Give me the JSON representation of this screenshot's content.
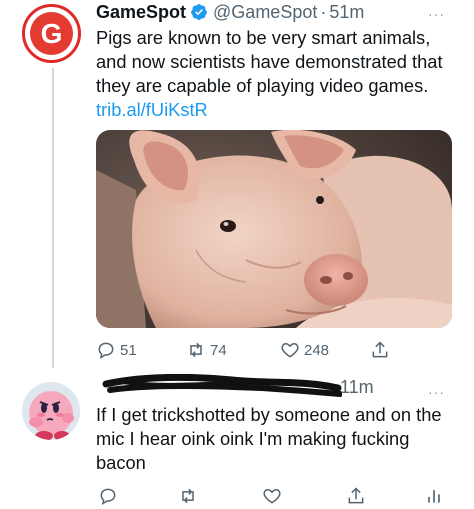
{
  "tweet1": {
    "display_name": "GameSpot",
    "handle": "@GameSpot",
    "separator": "·",
    "time": "51m",
    "more": "···",
    "text": "Pigs are known to be very smart animals, and now scientists have demonstrated that they are capable of playing video games.",
    "link": "trib.al/fUiKstR",
    "avatar_letter": "G",
    "stats": {
      "replies": "51",
      "retweets": "74",
      "likes": "248"
    }
  },
  "tweet2": {
    "time": "11m",
    "more": "···",
    "text": "If I get trickshotted by someone and on the mic I hear oink oink I'm making fucking bacon"
  },
  "icons": [
    "gamespot-logo",
    "verified-badge-icon",
    "more-icon",
    "reply-icon",
    "retweet-icon",
    "like-icon",
    "share-icon",
    "analytics-icon"
  ],
  "colors": {
    "accent": "#1d9bf0",
    "secondary_text": "#536471",
    "gamespot_red": "#e33b32"
  }
}
